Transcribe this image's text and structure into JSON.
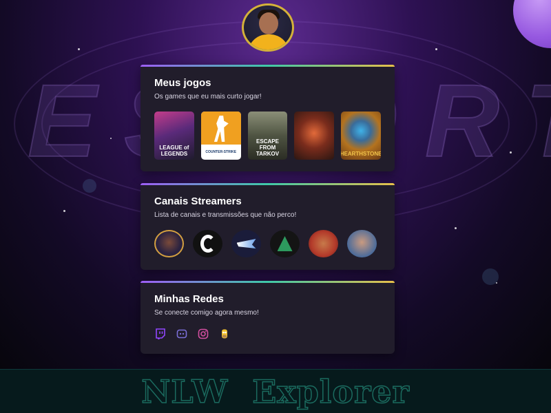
{
  "background": {
    "logo_text": "ESPORTS"
  },
  "games_card": {
    "title": "Meus jogos",
    "subtitle": "Os games que eu mais curto jogar!",
    "games": [
      {
        "label": "LEAGUE of LEGENDS",
        "icon": "league-of-legends-cover"
      },
      {
        "label": "COUNTER-STRIKE",
        "icon": "counter-strike-cover"
      },
      {
        "label": "ESCAPE FROM TARKOV",
        "icon": "tarkov-cover"
      },
      {
        "label": "",
        "icon": "path-of-exile-cover"
      },
      {
        "label": "HEARTHSTONE",
        "icon": "hearthstone-cover"
      }
    ]
  },
  "streamers_card": {
    "title": "Canais Streamers",
    "subtitle": "Lista de canais e transmissões que não perco!",
    "streamers": [
      {
        "icon": "streamer-avatar-1"
      },
      {
        "icon": "streamer-avatar-2"
      },
      {
        "icon": "streamer-avatar-3"
      },
      {
        "icon": "streamer-avatar-4"
      },
      {
        "icon": "streamer-avatar-5"
      },
      {
        "icon": "streamer-avatar-6"
      }
    ]
  },
  "social_card": {
    "title": "Minhas Redes",
    "subtitle": "Se conecte comigo agora mesmo!",
    "networks": [
      {
        "icon": "twitch-icon",
        "color": "#9146ff"
      },
      {
        "icon": "discord-icon",
        "color": "#7b6fd8"
      },
      {
        "icon": "instagram-icon",
        "color": "#d34fa0"
      },
      {
        "icon": "homer-icon",
        "color": "#f2c22e"
      }
    ]
  },
  "footer": {
    "title": "NLW Explorer"
  },
  "colors": {
    "accent_gradient": [
      "#9d5ef5",
      "#3fc9a8",
      "#e7c04a"
    ],
    "card_bg": "#211d2b"
  }
}
